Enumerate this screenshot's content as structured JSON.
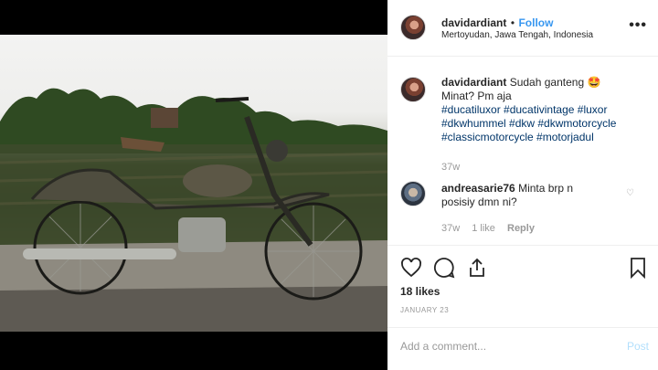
{
  "post": {
    "author": "davidardiant",
    "follow_label": "Follow",
    "separator": "•",
    "location": "Mertoyudan, Jawa Tengah, Indonesia",
    "more_icon": "more-dots-icon",
    "caption_line1": "Sudah ganteng 🤩",
    "caption_line2": "Minat? Pm aja",
    "hashtags_line1": "#ducatiluxor #ducativintage #luxor",
    "hashtags_line2": "#dkwhummel #dkw #dkwmotorcycle",
    "hashtags_line3": "#classicmotorcycle #motorjadul",
    "caption_age": "37w"
  },
  "comments": [
    {
      "author": "andreasarie76",
      "text_line1": "Minta brp n",
      "text_line2": "posisiy dmn ni?",
      "age": "37w",
      "likes": "1 like",
      "reply_label": "Reply"
    }
  ],
  "actions": {
    "like_icon": "heart-icon",
    "comment_icon": "comment-icon",
    "share_icon": "share-icon",
    "save_icon": "bookmark-icon",
    "likes_count": "18 likes",
    "date": "JANUARY 23"
  },
  "add_comment": {
    "placeholder": "Add a comment...",
    "post_label": "Post"
  }
}
